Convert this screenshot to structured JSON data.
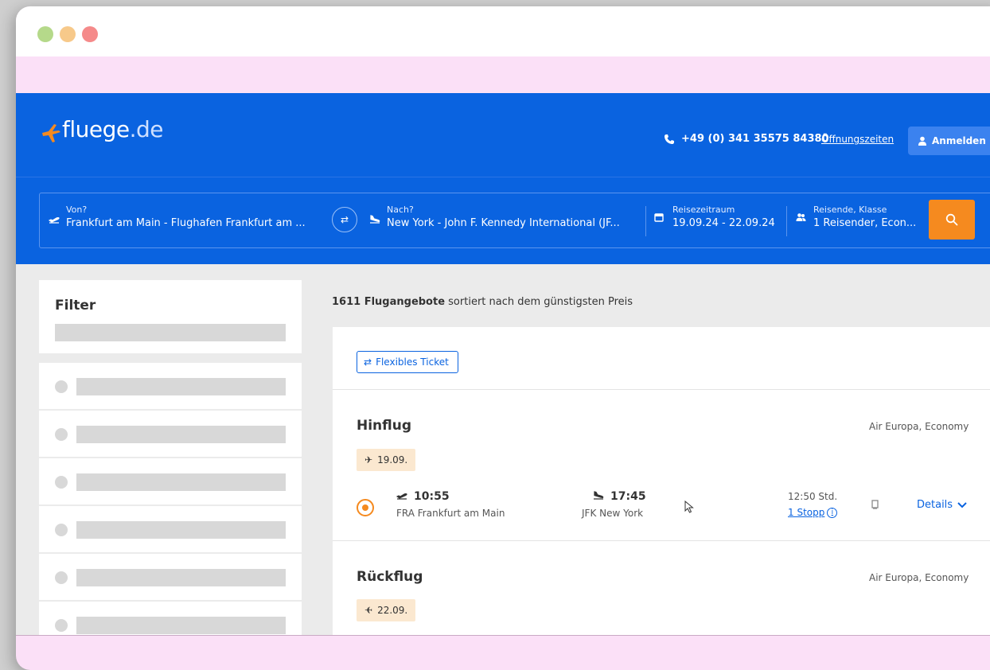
{
  "window": {
    "controls": [
      "green",
      "yellow",
      "red"
    ],
    "titlebar_color": "#ffffff",
    "page_bg": "#fbe0f7"
  },
  "site": {
    "logo_name": "fluege",
    "logo_tld": ".de",
    "brand_color": "#0a63e0",
    "accent_color": "#f58a1f"
  },
  "header": {
    "phone_icon": "phone-icon",
    "phone": "+49 (0) 341 35575 84380",
    "hours_link": "Öffnungszeiten",
    "login_icon": "user-icon",
    "login_label": "Anmelden"
  },
  "search": {
    "from": {
      "label": "Von?",
      "value": "Frankfurt am Main - Flughafen Frankfurt am ...",
      "icon": "takeoff-icon"
    },
    "swap_icon": "swap-icon",
    "to": {
      "label": "Nach?",
      "value": "New York - John F. Kennedy International (JF...",
      "icon": "landing-icon"
    },
    "dates": {
      "label": "Reisezeitraum",
      "value": "19.09.24 - 22.09.24",
      "icon": "calendar-icon"
    },
    "travellers": {
      "label": "Reisende, Klasse",
      "value": "1 Reisender, Econ...",
      "icon": "people-icon"
    },
    "search_icon": "search-icon"
  },
  "filter": {
    "title": "Filter"
  },
  "results": {
    "count": "1611 Flugangebote",
    "sort_text": " sortiert nach dem günstigsten Preis",
    "flex_ticket": "Flexibles Ticket",
    "outbound": {
      "title": "Hinflug",
      "airline": "Air Europa, Economy",
      "date": "19.09.",
      "dep_time": "10:55",
      "dep_place": "FRA Frankfurt am Main",
      "arr_time": "17:45",
      "arr_place": "JFK New York",
      "duration": "12:50 Std.",
      "stops": "1 Stopp",
      "details": "Details"
    },
    "return": {
      "title": "Rückflug",
      "airline": "Air Europa, Economy",
      "date": "22.09."
    }
  }
}
